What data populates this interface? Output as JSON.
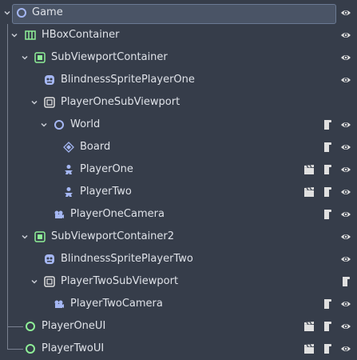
{
  "colors": {
    "background": "#363d4a",
    "selection": "#4a5466",
    "selection_border": "#6b7a93",
    "text": "#dfe2e8",
    "node_green": "#8eef97",
    "node_blue": "#a5b7f3",
    "node_purple": "#a5b7f3",
    "icon_light": "#e0e0e0",
    "tree_line": "#7a8190"
  },
  "nodes": [
    {
      "label": "Game",
      "icon": "node-2d-circle-icon",
      "icons": [
        "visibility-icon"
      ]
    },
    {
      "label": "HBoxContainer",
      "icon": "hbox-container-icon",
      "icons": [
        "visibility-icon"
      ]
    },
    {
      "label": "SubViewportContainer",
      "icon": "subviewport-container-icon",
      "icons": [
        "visibility-icon"
      ]
    },
    {
      "label": "BlindnessSpritePlayerOne",
      "icon": "sprite-icon",
      "icons": [
        "visibility-icon"
      ]
    },
    {
      "label": "PlayerOneSubViewport",
      "icon": "subviewport-icon",
      "icons": []
    },
    {
      "label": "World",
      "icon": "node-2d-circle-icon",
      "icons": [
        "script-icon",
        "visibility-icon"
      ]
    },
    {
      "label": "Board",
      "icon": "board-node-icon",
      "icons": [
        "script-icon",
        "visibility-icon"
      ]
    },
    {
      "label": "PlayerOne",
      "icon": "character-body-icon",
      "icons": [
        "scene-instance-icon",
        "script-icon",
        "visibility-icon"
      ]
    },
    {
      "label": "PlayerTwo",
      "icon": "character-body-icon",
      "icons": [
        "scene-instance-icon",
        "script-icon",
        "visibility-icon"
      ]
    },
    {
      "label": "PlayerOneCamera",
      "icon": "camera-icon",
      "icons": [
        "script-icon",
        "visibility-icon"
      ]
    },
    {
      "label": "SubViewportContainer2",
      "icon": "subviewport-container-icon",
      "icons": [
        "visibility-icon"
      ]
    },
    {
      "label": "BlindnessSpritePlayerTwo",
      "icon": "sprite-icon",
      "icons": [
        "visibility-icon"
      ]
    },
    {
      "label": "PlayerTwoSubViewport",
      "icon": "subviewport-icon",
      "icons": [
        "script-icon"
      ]
    },
    {
      "label": "PlayerTwoCamera",
      "icon": "camera-icon",
      "icons": [
        "script-icon",
        "visibility-icon"
      ]
    },
    {
      "label": "PlayerOneUI",
      "icon": "control-circle-icon",
      "icons": [
        "scene-instance-icon",
        "script-icon",
        "visibility-icon"
      ]
    },
    {
      "label": "PlayerTwoUI",
      "icon": "control-circle-icon",
      "icons": [
        "scene-instance-icon",
        "script-icon",
        "visibility-icon"
      ]
    }
  ]
}
